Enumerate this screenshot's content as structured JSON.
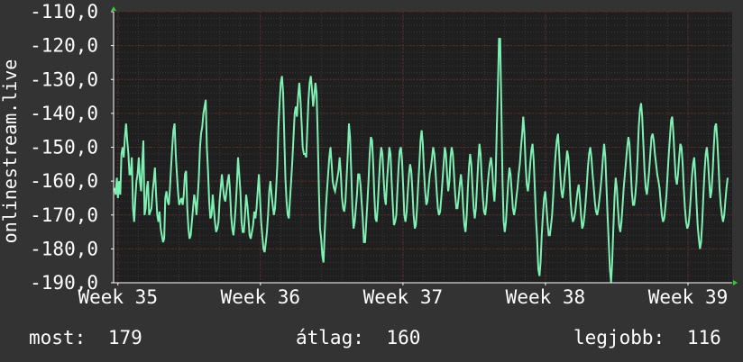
{
  "chart_data": {
    "type": "line",
    "ylabel": "onlinestream.live",
    "ylim": [
      -190,
      -110
    ],
    "y_ticks": [
      -110,
      -120,
      -130,
      -140,
      -150,
      -160,
      -170,
      -180,
      -190
    ],
    "y_tick_labels": [
      "-110,0",
      "-120,0",
      "-130,0",
      "-140,0",
      "-150,0",
      "-160,0",
      "-170,0",
      "-180,0",
      "-190,0"
    ],
    "x_ticks": [
      {
        "pos": 0.0,
        "label": "Week 35"
      },
      {
        "pos": 1.0,
        "label": "Week 36"
      },
      {
        "pos": 2.0,
        "label": "Week 37"
      },
      {
        "pos": 3.0,
        "label": "Week 38"
      },
      {
        "pos": 4.0,
        "label": "Week 39"
      }
    ],
    "xlim": [
      -0.03,
      4.31
    ],
    "grid": true,
    "line_color": "#7ff0b4",
    "series": [
      {
        "values": [
          -162,
          -164,
          -159,
          -165,
          -160,
          -164,
          -152,
          -150,
          -153,
          -147,
          -143,
          -148,
          -152,
          -158,
          -158,
          -153,
          -168,
          -172,
          -165,
          -160,
          -158,
          -153,
          -160,
          -163,
          -155,
          -148,
          -170,
          -168,
          -162,
          -160,
          -170,
          -169,
          -168,
          -163,
          -160,
          -156,
          -164,
          -170,
          -172,
          -169,
          -174,
          -176,
          -178,
          -177,
          -165,
          -163,
          -166,
          -167,
          -162,
          -156,
          -150,
          -145,
          -143,
          -152,
          -158,
          -163,
          -167,
          -166,
          -165,
          -167,
          -164,
          -158,
          -157,
          -168,
          -174,
          -177,
          -176,
          -172,
          -168,
          -164,
          -166,
          -170,
          -165,
          -159,
          -150,
          -146,
          -144,
          -140,
          -138,
          -136,
          -150,
          -157,
          -166,
          -171,
          -170,
          -164,
          -168,
          -172,
          -175,
          -174,
          -172,
          -166,
          -162,
          -158,
          -162,
          -165,
          -166,
          -163,
          -160,
          -158,
          -163,
          -170,
          -174,
          -176,
          -172,
          -167,
          -161,
          -153,
          -158,
          -163,
          -172,
          -175,
          -175,
          -170,
          -164,
          -167,
          -171,
          -176,
          -177,
          -175,
          -173,
          -169,
          -171,
          -168,
          -163,
          -158,
          -165,
          -172,
          -176,
          -180,
          -181,
          -178,
          -175,
          -170,
          -163,
          -160,
          -164,
          -167,
          -170,
          -168,
          -162,
          -155,
          -144,
          -137,
          -131,
          -129,
          -134,
          -146,
          -159,
          -166,
          -170,
          -171,
          -165,
          -160,
          -154,
          -147,
          -140,
          -138,
          -141,
          -135,
          -131,
          -136,
          -143,
          -150,
          -152,
          -152,
          -153,
          -144,
          -136,
          -131,
          -129,
          -133,
          -138,
          -135,
          -131,
          -134,
          -147,
          -163,
          -174,
          -177,
          -182,
          -184,
          -175,
          -168,
          -163,
          -158,
          -153,
          -150,
          -155,
          -160,
          -162,
          -163,
          -161,
          -159,
          -157,
          -153,
          -158,
          -165,
          -168,
          -169,
          -166,
          -159,
          -152,
          -143,
          -147,
          -157,
          -168,
          -174,
          -172,
          -168,
          -164,
          -158,
          -158,
          -161,
          -166,
          -171,
          -178,
          -178,
          -172,
          -166,
          -160,
          -152,
          -147,
          -148,
          -155,
          -164,
          -171,
          -172,
          -167,
          -160,
          -154,
          -150,
          -152,
          -159,
          -165,
          -167,
          -160,
          -155,
          -150,
          -152,
          -160,
          -167,
          -173,
          -172,
          -170,
          -163,
          -156,
          -151,
          -150,
          -154,
          -162,
          -170,
          -172,
          -169,
          -163,
          -158,
          -155,
          -157,
          -163,
          -170,
          -174,
          -173,
          -168,
          -161,
          -155,
          -148,
          -145,
          -149,
          -157,
          -163,
          -167,
          -166,
          -162,
          -158,
          -156,
          -153,
          -150,
          -152,
          -157,
          -163,
          -168,
          -170,
          -169,
          -165,
          -160,
          -155,
          -150,
          -152,
          -158,
          -163,
          -160,
          -153,
          -150,
          -152,
          -158,
          -164,
          -168,
          -168,
          -165,
          -161,
          -158,
          -162,
          -168,
          -173,
          -175,
          -170,
          -162,
          -156,
          -152,
          -155,
          -162,
          -168,
          -171,
          -168,
          -161,
          -154,
          -149,
          -152,
          -159,
          -165,
          -169,
          -170,
          -167,
          -162,
          -158,
          -155,
          -153,
          -156,
          -162,
          -166,
          -160,
          -145,
          -132,
          -118,
          -118,
          -138,
          -160,
          -172,
          -175,
          -172,
          -166,
          -160,
          -156,
          -158,
          -163,
          -168,
          -170,
          -168,
          -165,
          -162,
          -158,
          -155,
          -150,
          -146,
          -141,
          -146,
          -155,
          -161,
          -163,
          -160,
          -155,
          -151,
          -149,
          -154,
          -162,
          -171,
          -177,
          -186,
          -188,
          -184,
          -176,
          -170,
          -165,
          -163,
          -167,
          -172,
          -176,
          -176,
          -173,
          -170,
          -164,
          -157,
          -152,
          -148,
          -146,
          -151,
          -158,
          -163,
          -165,
          -162,
          -158,
          -155,
          -151,
          -153,
          -159,
          -166,
          -170,
          -172,
          -171,
          -169,
          -166,
          -163,
          -161,
          -165,
          -170,
          -174,
          -173,
          -170,
          -166,
          -161,
          -156,
          -152,
          -150,
          -153,
          -158,
          -162,
          -166,
          -169,
          -170,
          -168,
          -165,
          -162,
          -158,
          -153,
          -149,
          -153,
          -161,
          -170,
          -178,
          -186,
          -190,
          -184,
          -174,
          -165,
          -159,
          -162,
          -168,
          -173,
          -175,
          -172,
          -167,
          -162,
          -158,
          -154,
          -150,
          -147,
          -149,
          -156,
          -163,
          -167,
          -167,
          -164,
          -160,
          -153,
          -144,
          -139,
          -137,
          -141,
          -149,
          -157,
          -162,
          -164,
          -161,
          -157,
          -152,
          -147,
          -146,
          -148,
          -152,
          -155,
          -158,
          -160,
          -162,
          -166,
          -170,
          -172,
          -171,
          -168,
          -164,
          -158,
          -152,
          -147,
          -142,
          -141,
          -146,
          -153,
          -159,
          -161,
          -158,
          -153,
          -149,
          -150,
          -155,
          -162,
          -168,
          -172,
          -174,
          -173,
          -170,
          -165,
          -159,
          -155,
          -153,
          -158,
          -166,
          -173,
          -177,
          -180,
          -178,
          -172,
          -164,
          -157,
          -152,
          -150,
          -154,
          -160,
          -165,
          -163,
          -157,
          -150,
          -144,
          -143,
          -148,
          -155,
          -162,
          -167,
          -170,
          -172,
          -170,
          -166,
          -162,
          -159
        ]
      }
    ],
    "stats": [
      {
        "label": "most:",
        "value": "179"
      },
      {
        "label": "átlag:",
        "value": "160"
      },
      {
        "label": "legjobb:",
        "value": "116"
      }
    ]
  }
}
